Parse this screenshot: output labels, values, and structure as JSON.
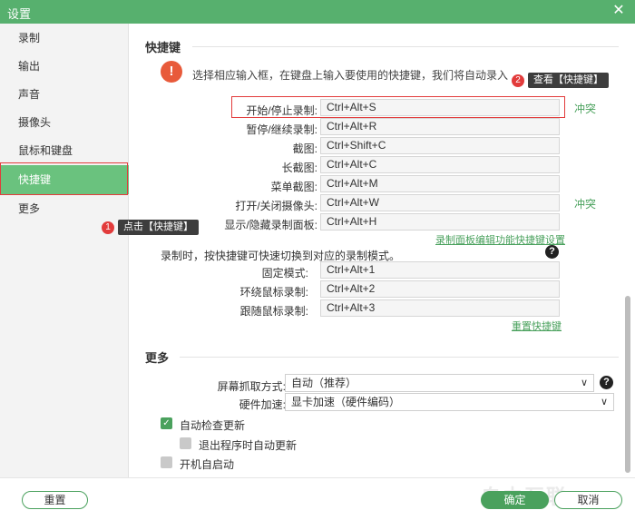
{
  "window": {
    "title": "设置",
    "close_glyph": "✕"
  },
  "colors": {
    "accent": "#57b06e",
    "highlight": "#e23b3b",
    "link": "#4aa15d",
    "warning": "#e85a3a"
  },
  "sidebar": {
    "items": [
      {
        "label": "录制"
      },
      {
        "label": "输出"
      },
      {
        "label": "声音"
      },
      {
        "label": "摄像头"
      },
      {
        "label": "鼠标和键盘"
      },
      {
        "label": "快捷键",
        "active": true
      },
      {
        "label": "更多"
      }
    ]
  },
  "callouts": {
    "one": {
      "num": "1",
      "text": "点击【快捷键】"
    },
    "two": {
      "num": "2",
      "text": "查看【快捷键】"
    }
  },
  "shortcuts": {
    "title": "快捷键",
    "notice_icon": "!",
    "notice": "选择相应输入框，在键盘上输入要使用的快捷键，我们将自动录入",
    "rows": [
      {
        "label": "开始/停止录制:",
        "value": "Ctrl+Alt+S",
        "conflict": "冲突"
      },
      {
        "label": "暂停/继续录制:",
        "value": "Ctrl+Alt+R"
      },
      {
        "label": "截图:",
        "value": "Ctrl+Shift+C"
      },
      {
        "label": "长截图:",
        "value": "Ctrl+Alt+C"
      },
      {
        "label": "菜单截图:",
        "value": "Ctrl+Alt+M"
      },
      {
        "label": "打开/关闭摄像头:",
        "value": "Ctrl+Alt+W",
        "conflict": "冲突"
      },
      {
        "label": "显示/隐藏录制面板:",
        "value": "Ctrl+Alt+H"
      }
    ],
    "panel_link": "录制面板编辑功能快捷键设置",
    "mode_note": "录制时，按快捷键可快速切换到对应的录制模式。",
    "help_glyph": "?",
    "mode_rows": [
      {
        "label": "固定模式:",
        "value": "Ctrl+Alt+1"
      },
      {
        "label": "环绕鼠标录制:",
        "value": "Ctrl+Alt+2"
      },
      {
        "label": "跟随鼠标录制:",
        "value": "Ctrl+Alt+3"
      }
    ],
    "reset_link": "重置快捷键"
  },
  "more": {
    "title": "更多",
    "capture_label": "屏幕抓取方式:",
    "capture_value": "自动（推荐）",
    "accel_label": "硬件加速:",
    "accel_value": "显卡加速（硬件编码）",
    "chevron_glyph": "∨",
    "check_glyph": "✓",
    "auto_update": {
      "label": "自动检查更新",
      "checked": true
    },
    "update_on_exit": {
      "label": "退出程序时自动更新",
      "checked": false
    },
    "autostart": {
      "label": "开机自启动",
      "checked": false
    }
  },
  "footer": {
    "reset": "重置",
    "ok": "确定",
    "cancel": "取消",
    "watermark": "自由互联"
  }
}
